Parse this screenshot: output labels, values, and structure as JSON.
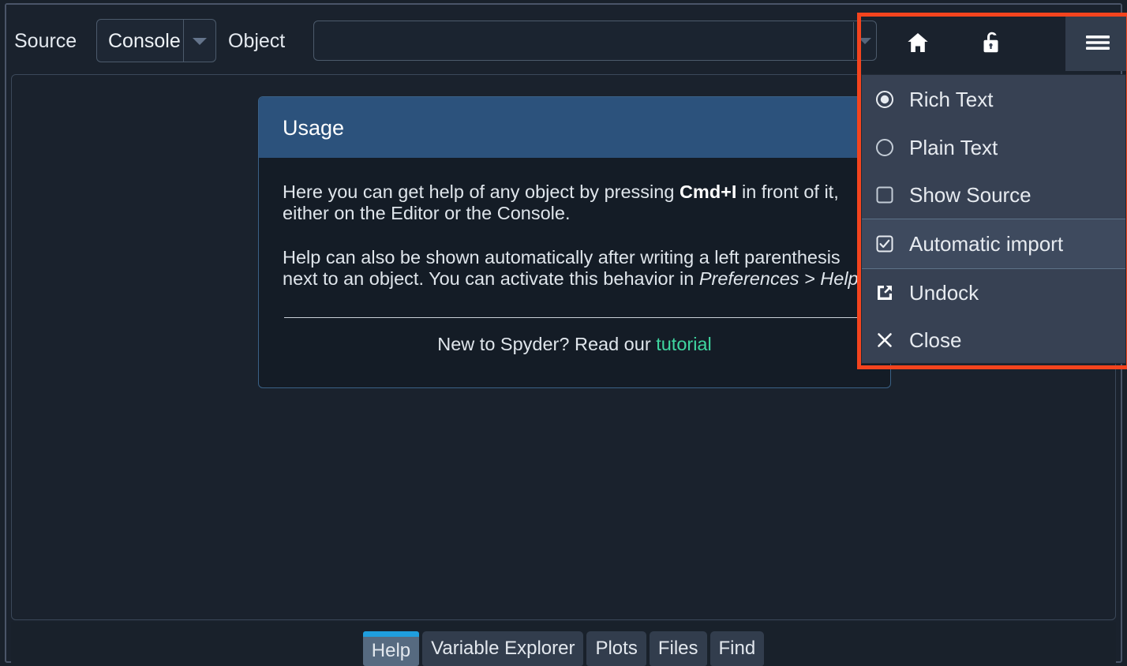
{
  "app": {
    "name": "Spyder Help Pane",
    "theme": "dark"
  },
  "colors": {
    "background": "#1a222d",
    "panel_header_blue": "#2c527c",
    "accent_blue": "#1f9ede",
    "link_teal": "#3fd6a0",
    "highlight_red": "#f4441e",
    "menu_background": "#374153",
    "active_tab": "#566a80"
  },
  "toolbar": {
    "source_label": "Source",
    "source_combo_value": "Console",
    "source_combo_icon": "chevron-down-icon",
    "object_label": "Object",
    "object_field_value": "",
    "object_field_placeholder": "",
    "object_field_icon": "chevron-down-icon",
    "buttons": [
      {
        "name": "home-icon",
        "label": "Home"
      },
      {
        "name": "unlock-icon",
        "label": "Lock/Unlock"
      },
      {
        "name": "hamburger-menu-icon",
        "label": "Options"
      }
    ]
  },
  "usage_panel": {
    "title": "Usage",
    "paragraph1": {
      "before": "Here you can get help of any object by pressing ",
      "shortcut": "Cmd+I",
      "after": " in front of it, either on the Editor or the Console."
    },
    "paragraph2": {
      "before": "Help can also be shown automatically after writing a left parenthesis next to an object. You can activate this behavior in ",
      "emphasis": "Preferences > Help",
      "after": "."
    },
    "footer": {
      "text": "New to Spyder? Read our ",
      "link_text": "tutorial"
    }
  },
  "dropdown_menu": {
    "items": [
      {
        "label": "Rich Text",
        "icon": "radio-selected-icon",
        "type": "radio",
        "checked": true,
        "highlighted": false
      },
      {
        "label": "Plain Text",
        "icon": "radio-unselected-icon",
        "type": "radio",
        "checked": false,
        "highlighted": false
      },
      {
        "label": "Show Source",
        "icon": "checkbox-unchecked-icon",
        "type": "checkbox",
        "checked": false,
        "highlighted": false
      },
      {
        "label": "Automatic import",
        "icon": "checkbox-checked-icon",
        "type": "checkbox",
        "checked": true,
        "highlighted": true
      },
      {
        "label": "Undock",
        "icon": "external-link-icon",
        "type": "action",
        "checked": false,
        "highlighted": false
      },
      {
        "label": "Close",
        "icon": "close-x-icon",
        "type": "action",
        "checked": false,
        "highlighted": false
      }
    ]
  },
  "tabs": [
    {
      "label": "Help",
      "active": true
    },
    {
      "label": "Variable Explorer",
      "active": false
    },
    {
      "label": "Plots",
      "active": false
    },
    {
      "label": "Files",
      "active": false
    },
    {
      "label": "Find",
      "active": false
    }
  ]
}
